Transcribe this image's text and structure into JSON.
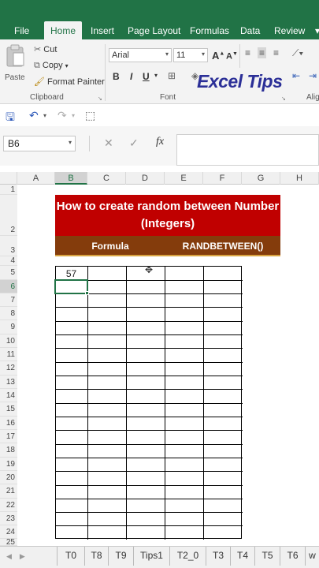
{
  "ribbon": {
    "tabs": [
      "File",
      "Home",
      "Insert",
      "Page Layout",
      "Formulas",
      "Data",
      "Review"
    ],
    "active_tab": "Home",
    "clipboard": {
      "paste": "Paste",
      "cut": "Cut",
      "copy": "Copy",
      "format_painter": "Format Painter",
      "group_label": "Clipboard"
    },
    "font": {
      "name": "Arial",
      "size": "11",
      "group_label": "Font",
      "bold": "B",
      "italic": "I",
      "underline": "U",
      "grow": "A",
      "shrink": "A"
    },
    "alignment_label": "Alig",
    "logo": "Excel Tips"
  },
  "formula_bar": {
    "name_box": "B6",
    "fx": "fx",
    "content": ""
  },
  "sheet": {
    "columns": [
      "A",
      "B",
      "C",
      "D",
      "E",
      "F",
      "G",
      "H"
    ],
    "selected_column": "B",
    "rows": [
      "1",
      "2",
      "3",
      "4",
      "5",
      "6",
      "7",
      "8",
      "9",
      "10",
      "11",
      "12",
      "13",
      "14",
      "15",
      "16",
      "17",
      "18",
      "19",
      "20",
      "21",
      "22",
      "23",
      "24",
      "25"
    ],
    "selected_row": "6",
    "title": "How to create random between Number (Integers)",
    "subheader": {
      "left": "Formula",
      "right": "RANDBETWEEN()"
    },
    "cell_b5": "57"
  },
  "sheet_tabs": [
    "T0",
    "T8",
    "T9",
    "Tips1",
    "T2_0",
    "T3",
    "T4",
    "T5",
    "T6",
    "w"
  ],
  "colors": {
    "accent": "#217346",
    "title_bg": "#c00000",
    "subheader_bg": "#843c0c",
    "logo": "#2b2f97"
  }
}
